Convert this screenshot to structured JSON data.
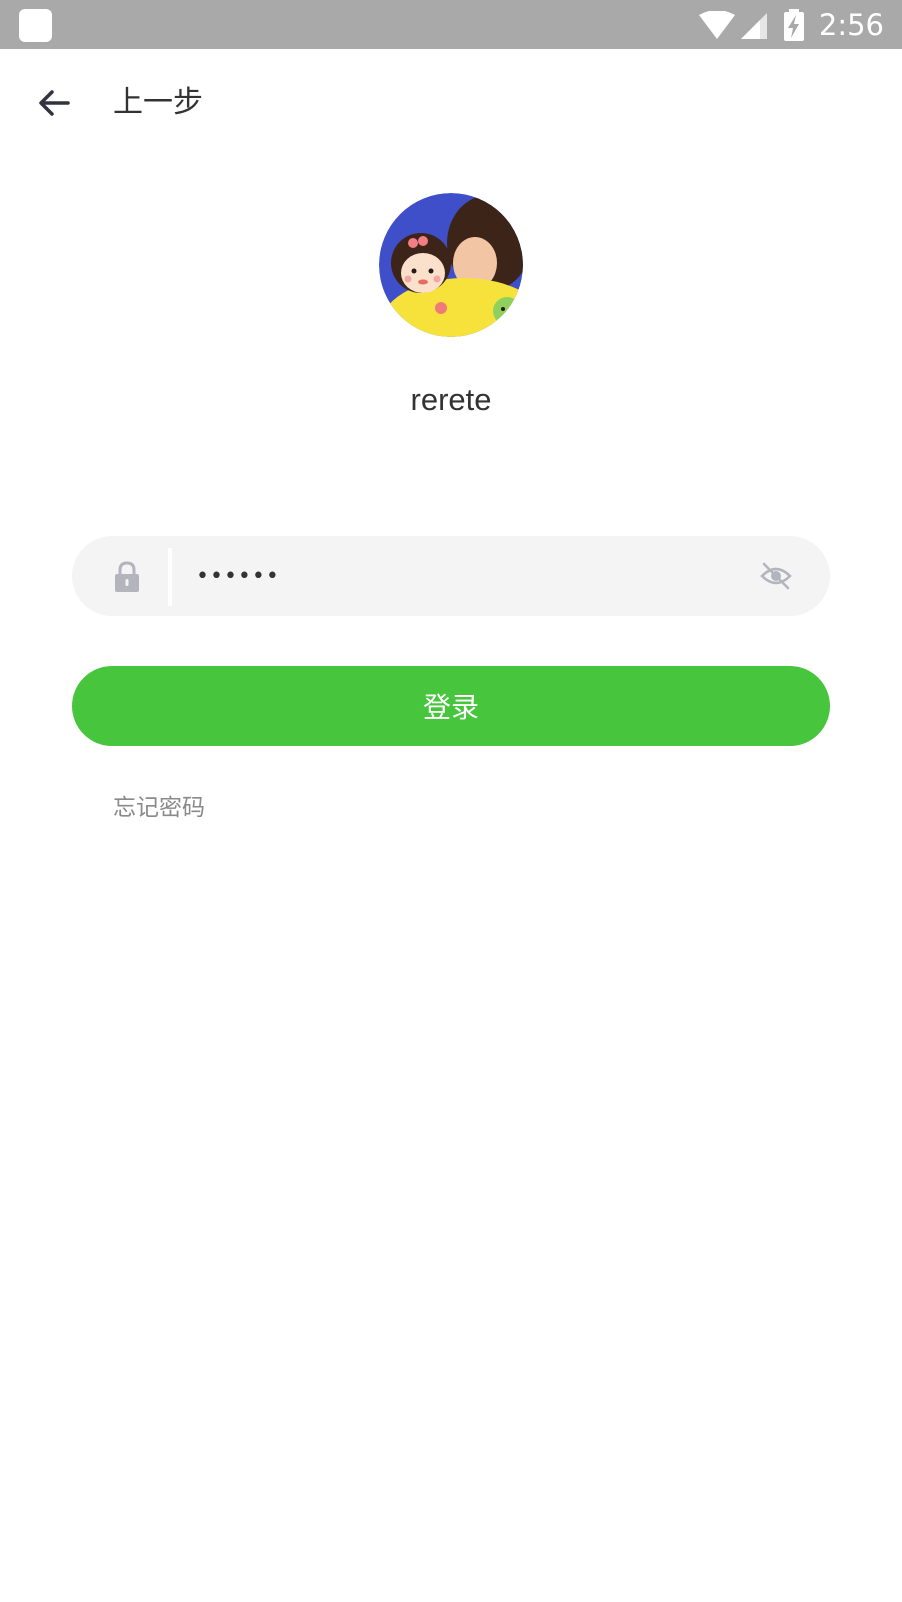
{
  "status_bar": {
    "time": "2:56",
    "icons": [
      "app-notification-icon",
      "wifi-icon",
      "cell-signal-icon",
      "battery-charging-icon"
    ]
  },
  "header": {
    "back_icon": "arrow-left-icon",
    "title": "上一步"
  },
  "profile": {
    "username": "rerete"
  },
  "password_field": {
    "value": "••••••",
    "lock_icon": "lock-icon",
    "visibility_icon": "eye-off-icon"
  },
  "login_button": {
    "label": "登录"
  },
  "forgot_link": {
    "label": "忘记密码"
  },
  "colors": {
    "status_bar": "#a9a9a9",
    "accent": "#47c53d",
    "field_bg": "#f4f4f4",
    "muted_text": "#8a8a8a",
    "icon_gray": "#b4b4bc"
  }
}
